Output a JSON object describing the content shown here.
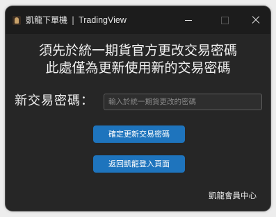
{
  "window": {
    "app_name": "凱龍下單機",
    "separator": "|",
    "app_subtitle": "TradingView",
    "controls": [
      "minimize-icon",
      "maximize-icon",
      "close-icon"
    ]
  },
  "notice": {
    "line1": "須先於統一期貨官方更改交易密碼",
    "line2": "此處僅為更新使用新的交易密碼"
  },
  "form": {
    "password_label": "新交易密碼：",
    "password_placeholder": "輸入於統一期貨更改的密碼",
    "password_value": ""
  },
  "buttons": {
    "confirm_label": "確定更新交易密碼",
    "back_label": "返回凱龍登入頁面"
  },
  "footer": {
    "member_center_label": "凱龍會員中心"
  },
  "colors": {
    "window_bg": "#262626",
    "titlebar_bg": "#1c1c1c",
    "button_bg": "#1e74bd",
    "text": "#f2f2f2"
  }
}
